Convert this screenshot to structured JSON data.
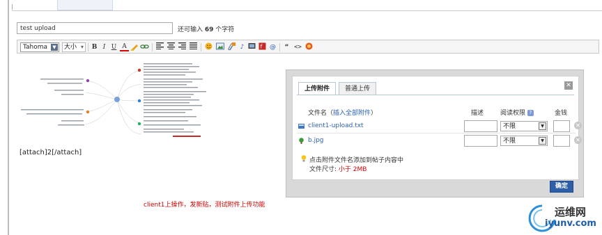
{
  "subject": {
    "value": "test upload",
    "hint_prefix": "还可输入",
    "hint_count": "69",
    "hint_suffix": "个字符"
  },
  "toolbar": {
    "font_family": "Tahoma",
    "font_size": "大小",
    "buttons": [
      {
        "label": "B",
        "icon": "bold-icon"
      },
      {
        "label": "I",
        "icon": "italic-icon"
      },
      {
        "label": "U",
        "icon": "underline-icon"
      },
      {
        "label": "A",
        "icon": "font-color-icon"
      },
      {
        "label": "",
        "icon": "highlight-icon"
      },
      {
        "label": "",
        "icon": "link-icon"
      },
      {
        "label": "",
        "icon": "align-left-icon"
      },
      {
        "label": "",
        "icon": "align-center-icon"
      },
      {
        "label": "",
        "icon": "align-right-icon"
      },
      {
        "label": "",
        "icon": "align-justify-icon"
      },
      {
        "label": "",
        "icon": "smiley-icon"
      },
      {
        "label": "",
        "icon": "image-icon"
      },
      {
        "label": "",
        "icon": "attachment-icon"
      },
      {
        "label": "",
        "icon": "music-icon"
      },
      {
        "label": "",
        "icon": "video-icon"
      },
      {
        "label": "",
        "icon": "flash-icon"
      },
      {
        "label": "@",
        "icon": "mention-icon"
      },
      {
        "label": "“",
        "icon": "quote-icon"
      },
      {
        "label": "<>",
        "icon": "code-icon"
      },
      {
        "label": "",
        "icon": "money-icon"
      }
    ]
  },
  "editor": {
    "attach_text": "[attach]2[/attach]",
    "annotation": "client1上操作，发新贴，测试附件上传功能"
  },
  "dialog": {
    "tabs": [
      "上传附件",
      "普通上传"
    ],
    "columns": {
      "filename": "文件名",
      "insert_all": "插入全部附件",
      "description": "描述",
      "permission": "阅读权限",
      "price": "金钱"
    },
    "files": [
      {
        "name": "client1-upload.txt",
        "permission": "不限",
        "icon": "text-file-icon"
      },
      {
        "name": "b.jpg",
        "permission": "不限",
        "icon": "image-file-icon"
      }
    ],
    "tip": "点击附件文件名添加到帖子内容中",
    "size_label": "文件尺寸:",
    "size_value": "小于 2MB",
    "confirm": "确定"
  },
  "watermark": {
    "name": "运维网",
    "url": "iyunv.com"
  },
  "colors": {
    "link": "#2b61b3",
    "note_red": "#d20000",
    "confirm_bg": "#2f5fa8"
  }
}
